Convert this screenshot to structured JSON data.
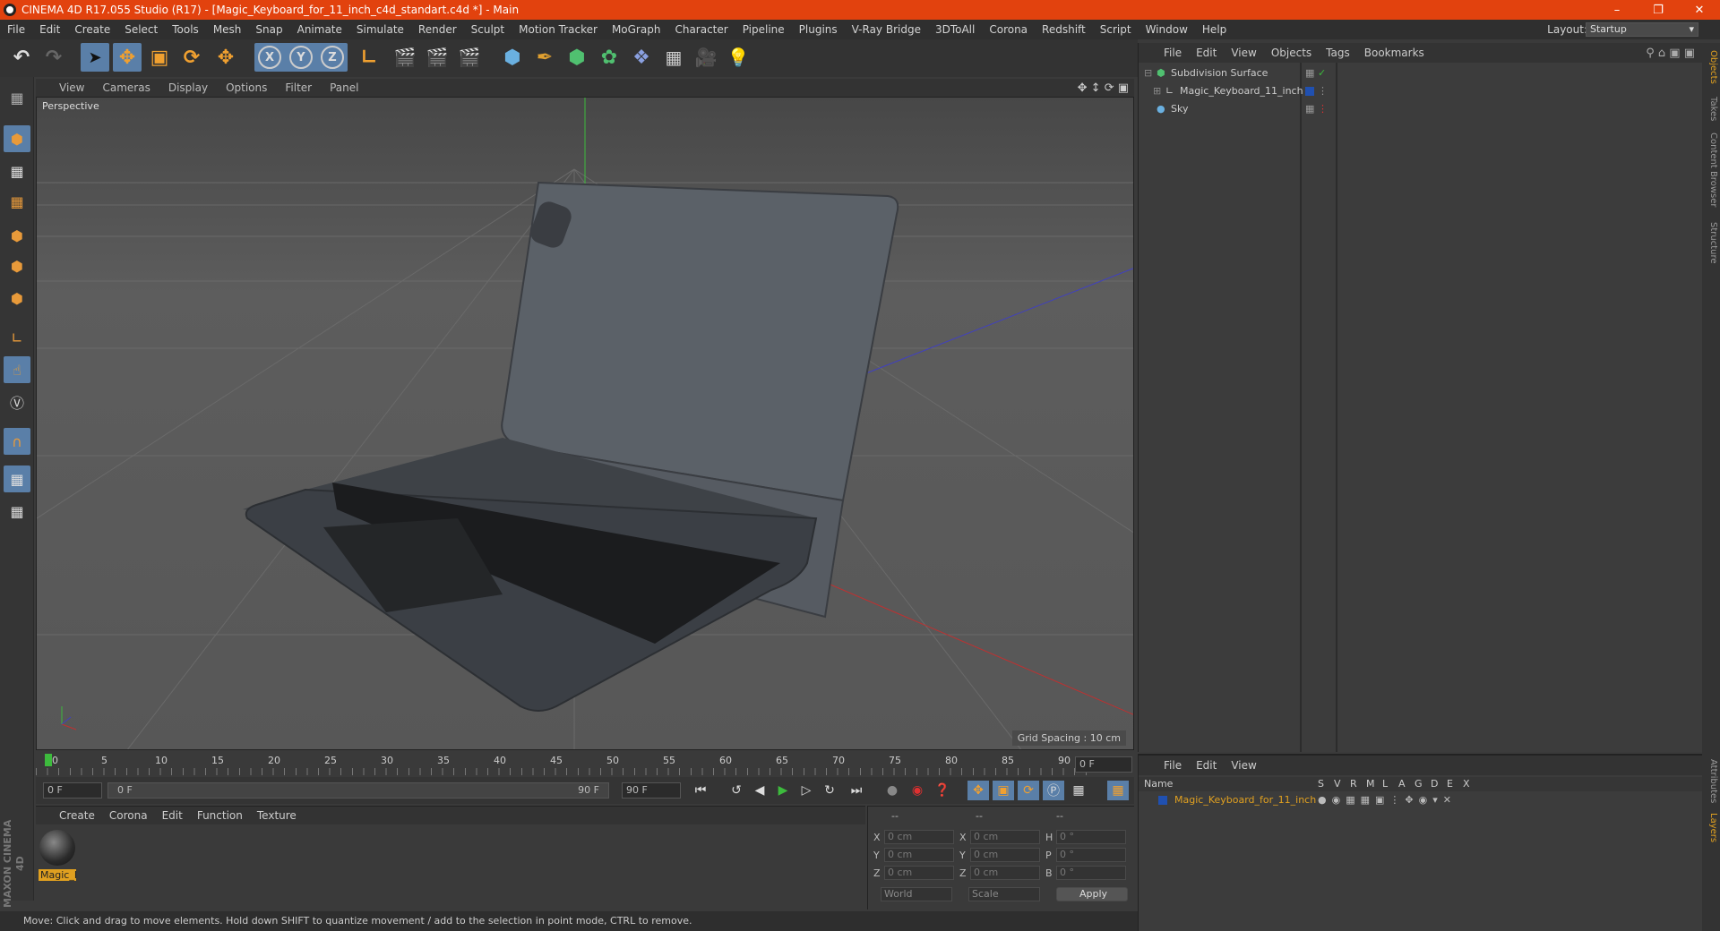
{
  "window": {
    "title": "CINEMA 4D R17.055 Studio (R17) - [Magic_Keyboard_for_11_inch_c4d_standart.c4d *] - Main"
  },
  "menubar": {
    "items": [
      "File",
      "Edit",
      "Create",
      "Select",
      "Tools",
      "Mesh",
      "Snap",
      "Animate",
      "Simulate",
      "Render",
      "Sculpt",
      "Motion Tracker",
      "MoGraph",
      "Character",
      "Pipeline",
      "Plugins",
      "V-Ray Bridge",
      "3DToAll",
      "Corona",
      "Redshift",
      "Script",
      "Window",
      "Help"
    ],
    "layout_label": "Layout:",
    "layout_value": "Startup"
  },
  "toolbar": {
    "axis_x": "X",
    "axis_y": "Y",
    "axis_z": "Z"
  },
  "viewport": {
    "menu": [
      "View",
      "Cameras",
      "Display",
      "Options",
      "Filter",
      "Panel"
    ],
    "label": "Perspective",
    "grid_spacing": "Grid Spacing : 10 cm"
  },
  "timeline": {
    "ticks": [
      "0",
      "5",
      "10",
      "15",
      "20",
      "25",
      "30",
      "35",
      "40",
      "45",
      "50",
      "55",
      "60",
      "65",
      "70",
      "75",
      "80",
      "85",
      "90"
    ],
    "end_frame_field": "0 F"
  },
  "timectrl": {
    "start": "0 F",
    "current": "0 F",
    "slider_end": "90 F",
    "end": "90 F"
  },
  "materials": {
    "menu": [
      "Create",
      "Corona",
      "Edit",
      "Function",
      "Texture"
    ],
    "mat_name": "Magic_K"
  },
  "coords": {
    "header": [
      "--",
      "--",
      "--"
    ],
    "rows": [
      {
        "l1": "X",
        "v1": "0 cm",
        "l2": "X",
        "v2": "0 cm",
        "l3": "H",
        "v3": "0 °"
      },
      {
        "l1": "Y",
        "v1": "0 cm",
        "l2": "Y",
        "v2": "0 cm",
        "l3": "P",
        "v3": "0 °"
      },
      {
        "l1": "Z",
        "v1": "0 cm",
        "l2": "Z",
        "v2": "0 cm",
        "l3": "B",
        "v3": "0 °"
      }
    ],
    "world": "World",
    "scale": "Scale",
    "apply": "Apply"
  },
  "objects": {
    "menu": [
      "File",
      "Edit",
      "View",
      "Objects",
      "Tags",
      "Bookmarks"
    ],
    "items": [
      {
        "name": "Subdivision Surface"
      },
      {
        "name": "Magic_Keyboard_11_inch"
      },
      {
        "name": "Sky"
      }
    ]
  },
  "layers": {
    "menu": [
      "File",
      "Edit",
      "View"
    ],
    "header": {
      "name": "Name",
      "cols": [
        "S",
        "V",
        "R",
        "M",
        "L",
        "A",
        "G",
        "D",
        "E",
        "X"
      ]
    },
    "row": "Magic_Keyboard_for_11_inch"
  },
  "sidetabs": [
    "Objects",
    "Takes",
    "Content Browser",
    "Structure",
    "Attributes",
    "Layers"
  ],
  "status": "Move: Click and drag to move elements. Hold down SHIFT to quantize movement / add to the selection in point mode, CTRL to remove.",
  "colors": {
    "accent": "#e2420e",
    "selection": "#5a7fa8",
    "layer_name": "#e0a020"
  }
}
